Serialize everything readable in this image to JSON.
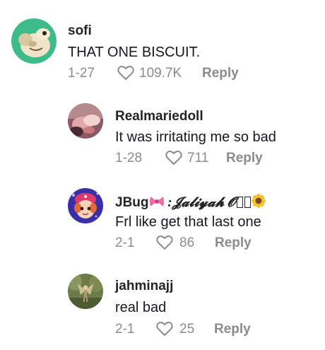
{
  "comments": [
    {
      "username": "sofi",
      "text": "THAT ONE BISCUIT.",
      "date": "1-27",
      "likes": "109.7K",
      "reply_label": "Reply",
      "avatar_icon": "avatar-dog-mint-bg"
    },
    {
      "username": "Realmariedoll",
      "text": "It was irritating me so bad",
      "date": "1-28",
      "likes": "711",
      "reply_label": "Reply",
      "avatar_icon": "avatar-photo-pink"
    },
    {
      "username_main": "JBug",
      "username_rest": " :𝓙𝓪𝓵𝓲𝔂𝓪𝓱 𝓞",
      "username_emojis": [
        "ribbon-emoji",
        "sunflower-emoji"
      ],
      "text": "Frl like get that last one",
      "date": "2-1",
      "likes": "86",
      "reply_label": "Reply",
      "avatar_icon": "avatar-strawberry-shortcake"
    },
    {
      "username": "jahminajj",
      "text": "real bad",
      "date": "2-1",
      "likes": "25",
      "reply_label": "Reply",
      "avatar_icon": "avatar-fairy-forest"
    }
  ],
  "colors": {
    "username": "#222426",
    "text": "#161823",
    "meta": "#8a8b91"
  }
}
